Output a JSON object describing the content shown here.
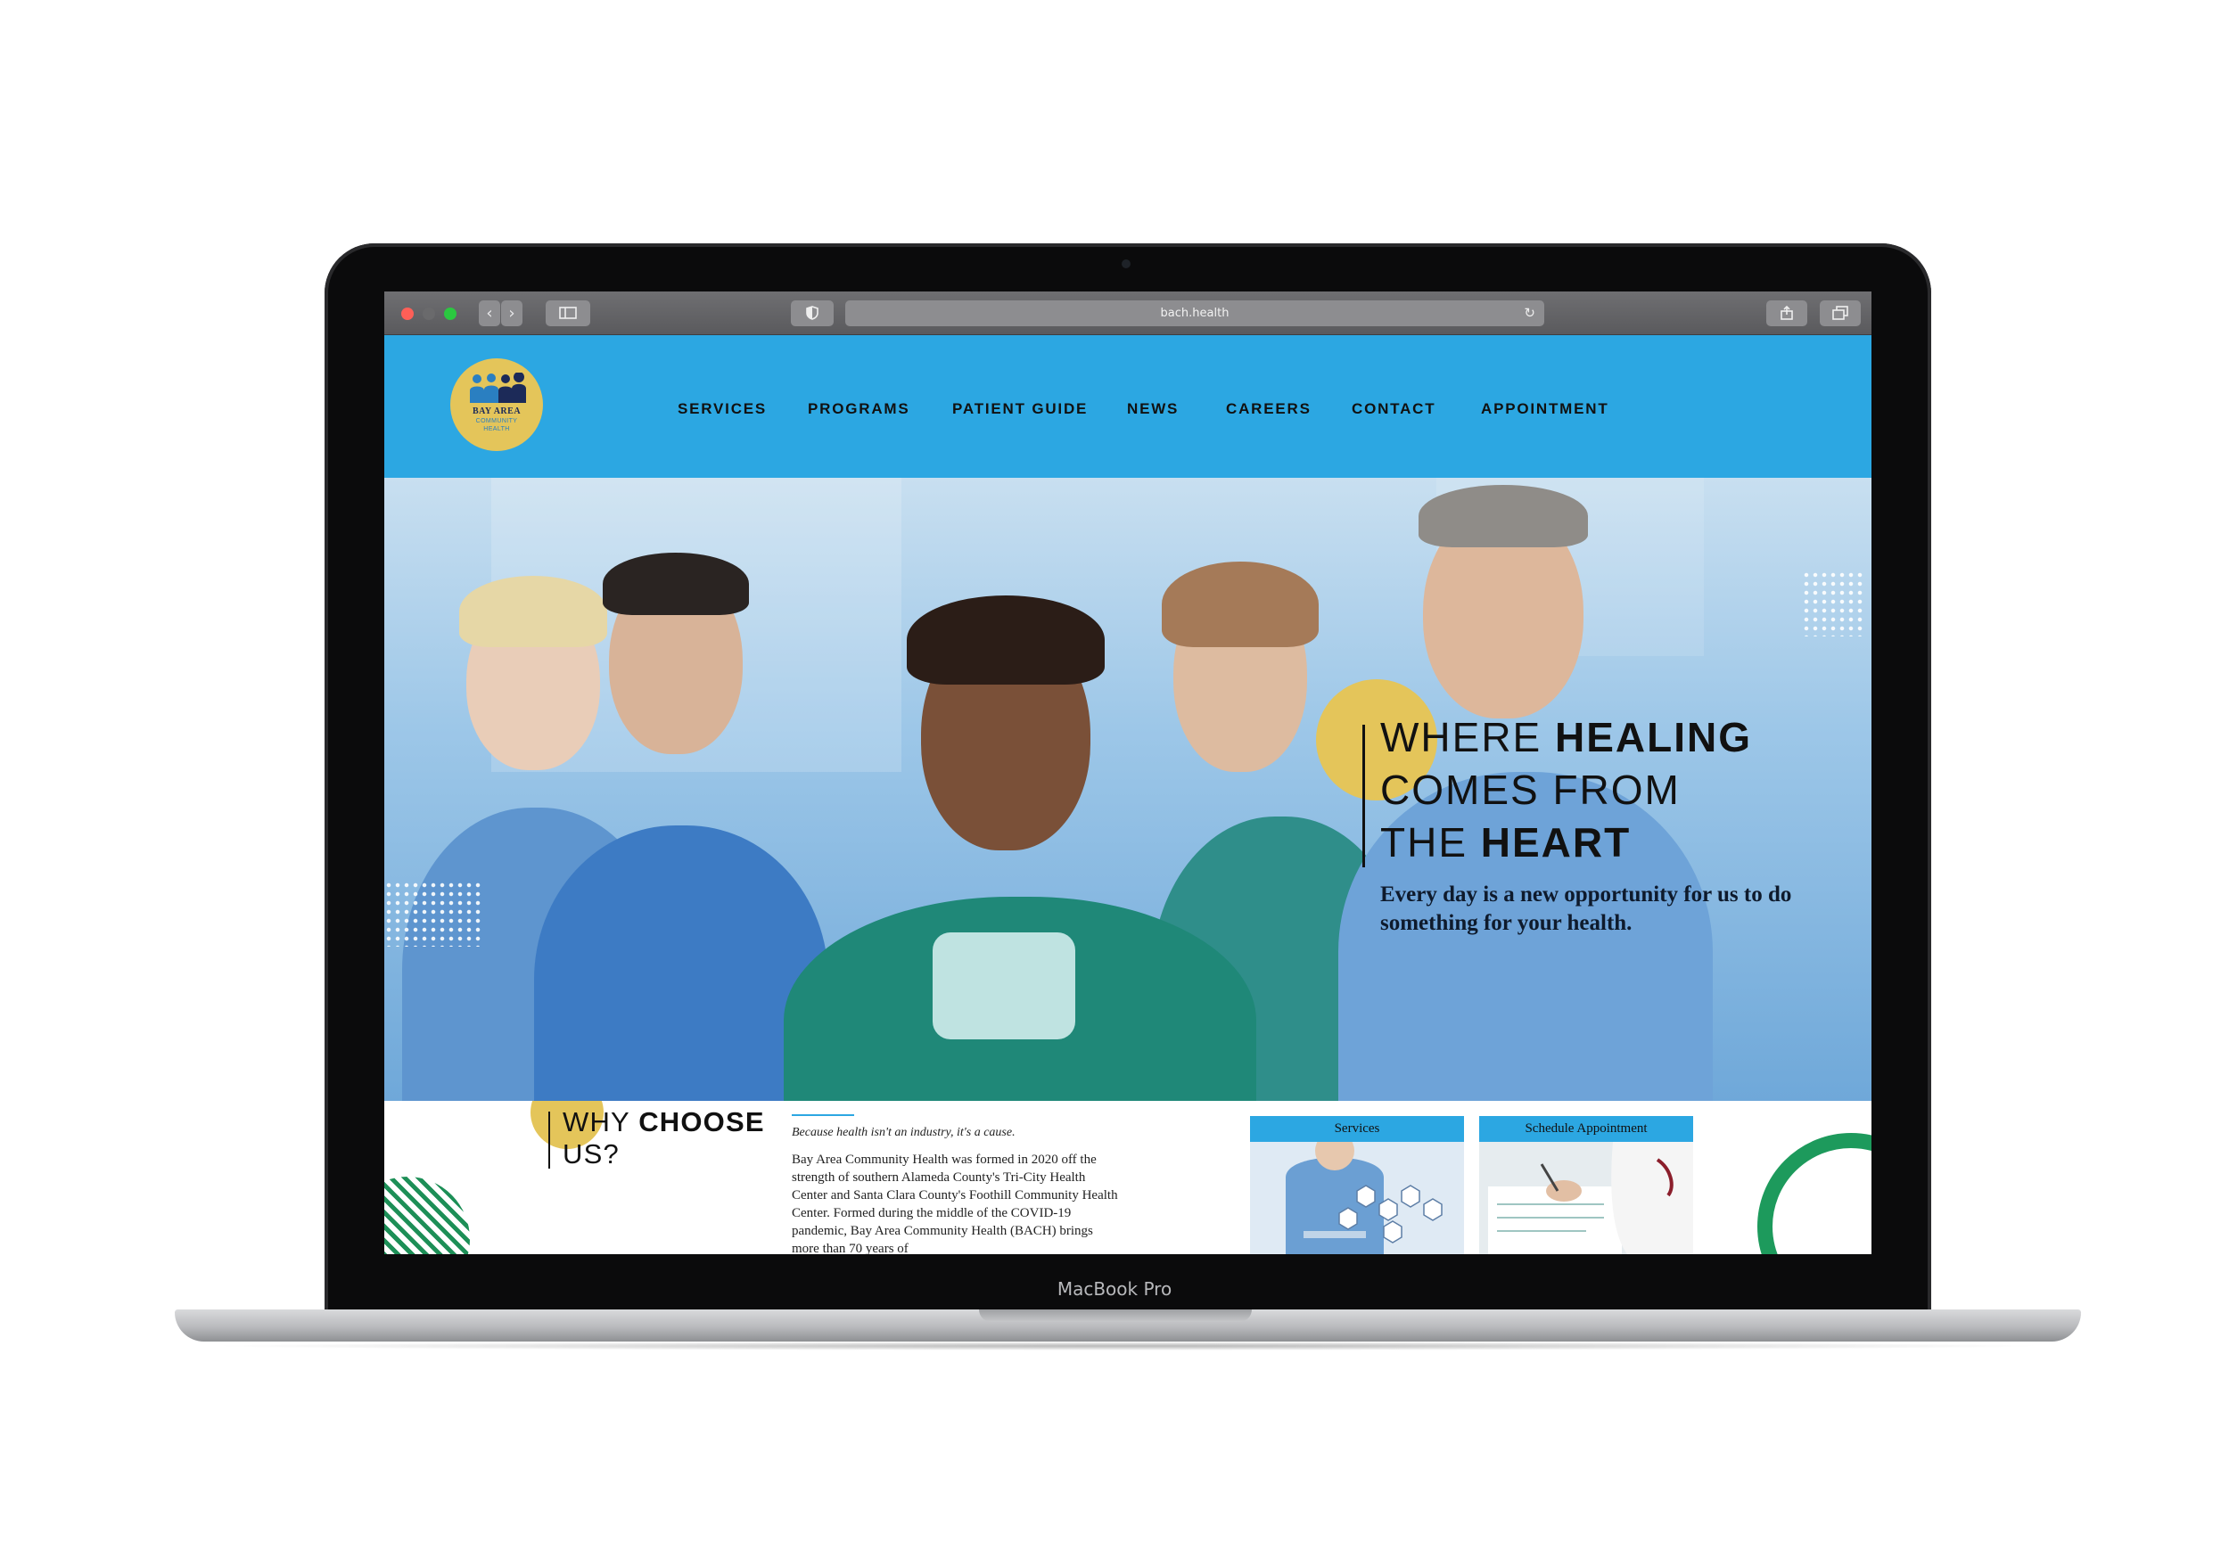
{
  "browser": {
    "url": "bach.health",
    "icons": [
      "back-icon",
      "forward-icon",
      "sidebar-icon",
      "shield-icon",
      "reload-icon",
      "share-icon",
      "tabs-icon"
    ]
  },
  "site": {
    "logo": {
      "line1": "BAY AREA",
      "line2": "COMMUNITY",
      "line3": "HEALTH"
    },
    "nav": [
      "SERVICES",
      "PROGRAMS",
      "PATIENT GUIDE",
      "NEWS",
      "CAREERS",
      "CONTACT",
      "APPOINTMENT"
    ]
  },
  "hero": {
    "line1_light": "WHERE ",
    "line1_bold": "HEALING",
    "line2_light": "COMES FROM",
    "line3_light": "THE ",
    "line3_bold": "HEART",
    "subtitle": "Every day is a new opportunity for us to do something for your health."
  },
  "why": {
    "title_light": "WHY ",
    "title_bold": "CHOOSE",
    "title_line2": "US?",
    "tagline": "Because health isn't an industry, it's a cause.",
    "body": "Bay Area Community Health was formed in 2020 off the strength of southern Alameda County's Tri-City Health Center and Santa Clara County's Foothill Community Health Center. Formed during the middle of the COVID-19 pandemic, Bay Area Community Health (BACH) brings more than 70 years of"
  },
  "cards": [
    {
      "label": "Services"
    },
    {
      "label": "Schedule Appointment"
    }
  ],
  "device": {
    "label": "MacBook Pro"
  },
  "colors": {
    "brand_blue": "#2ca7e2",
    "brand_yellow": "#e4c55a",
    "brand_green": "#1d9a5c"
  }
}
